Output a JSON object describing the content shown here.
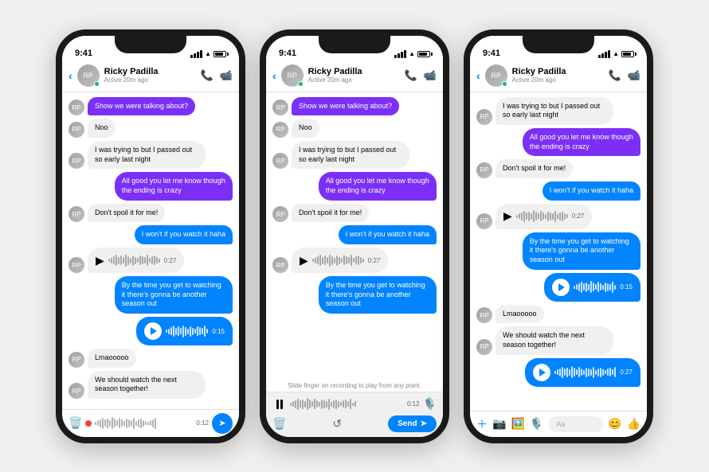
{
  "phones": [
    {
      "id": "phone-left",
      "time": "9:41",
      "contact": "Ricky Padilla",
      "status": "Active 20m ago",
      "messages": [
        {
          "type": "received-trunc",
          "text": "Show we were talking about?"
        },
        {
          "type": "received",
          "text": "Noo"
        },
        {
          "type": "received",
          "text": "I was trying to but I passed out so early last night"
        },
        {
          "type": "sent-purple",
          "text": "All good you let me know though the ending is crazy"
        },
        {
          "type": "received",
          "text": "Don't spoil it for me!"
        },
        {
          "type": "sent-blue",
          "text": "I won't if you watch it haha"
        },
        {
          "type": "audio-received",
          "duration": "0:27"
        },
        {
          "type": "sent-text-blue",
          "text": "By the time you get to watching it there's gonna be another season out"
        },
        {
          "type": "audio-sent",
          "duration": "0:15"
        },
        {
          "type": "received",
          "text": "Lmaooooo"
        },
        {
          "type": "received",
          "text": "We should watch the next season together!"
        }
      ],
      "bottomType": "recording",
      "recordDuration": "0:12"
    },
    {
      "id": "phone-middle",
      "time": "9:41",
      "contact": "Ricky Padilla",
      "status": "Active 20m ago",
      "messages": [
        {
          "type": "received-trunc",
          "text": "Show we were talking about?"
        },
        {
          "type": "received",
          "text": "Noo"
        },
        {
          "type": "received",
          "text": "I was trying to but I passed out so early last night"
        },
        {
          "type": "sent-purple",
          "text": "All good you let me know though the ending is crazy"
        },
        {
          "type": "received",
          "text": "Don't spoil it for me!"
        },
        {
          "type": "sent-blue",
          "text": "I won't if you watch it haha"
        },
        {
          "type": "audio-received",
          "duration": "0:27"
        },
        {
          "type": "sent-text-blue",
          "text": "By the time you get to watching it there's gonna be another season out"
        }
      ],
      "bottomType": "middle-recording",
      "slideHint": "Slide finger on recording to play from any point.",
      "recordDuration": "0:12"
    },
    {
      "id": "phone-right",
      "time": "9:41",
      "contact": "Ricky Padilla",
      "status": "Active 20m ago",
      "messages": [
        {
          "type": "received",
          "text": "I was trying to but I passed out so early last night"
        },
        {
          "type": "sent-purple",
          "text": "All good you let me know though the ending is crazy"
        },
        {
          "type": "received",
          "text": "Don't spoil it for me!"
        },
        {
          "type": "sent-blue",
          "text": "I won't if you watch it haha"
        },
        {
          "type": "audio-received",
          "duration": "0:27"
        },
        {
          "type": "sent-text-blue",
          "text": "By the time you get to watching it there's gonna be another season out"
        },
        {
          "type": "audio-sent",
          "duration": "0:15"
        },
        {
          "type": "received",
          "text": "Lmaooooo"
        },
        {
          "type": "received",
          "text": "We should watch the next season together!"
        },
        {
          "type": "audio-sent-large",
          "duration": "0:27"
        }
      ],
      "bottomType": "icons"
    }
  ],
  "waveHeights": [
    4,
    7,
    10,
    14,
    9,
    12,
    8,
    15,
    11,
    7,
    13,
    9,
    6,
    12,
    10,
    8,
    14,
    6,
    10,
    12,
    8,
    5
  ],
  "waveHeightsLarge": [
    4,
    7,
    10,
    14,
    9,
    12,
    8,
    15,
    11,
    7,
    13,
    9,
    6,
    12,
    10,
    8,
    14,
    6,
    10,
    12,
    8,
    5,
    9,
    11,
    7,
    13
  ]
}
